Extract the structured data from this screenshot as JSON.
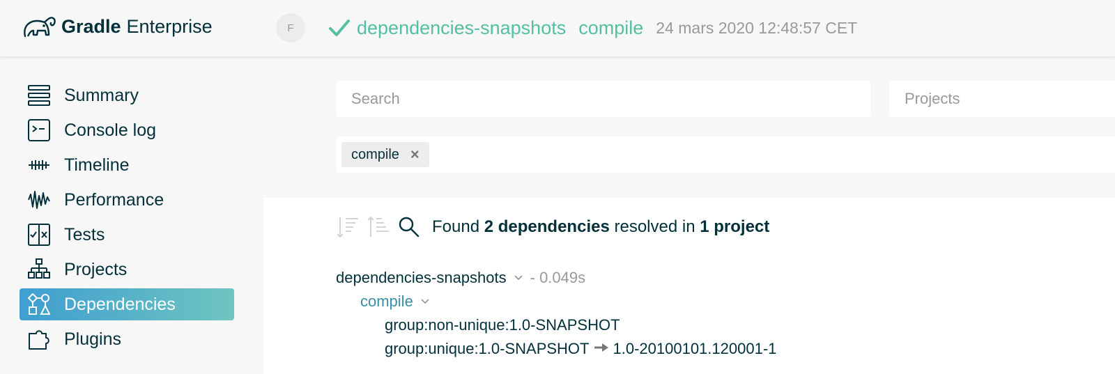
{
  "header": {
    "brand": "Gradle",
    "product": "Enterprise",
    "avatar_initial": "F",
    "build_project": "dependencies-snapshots",
    "build_task": "compile",
    "build_time": "24 mars 2020 12:48:57 CET"
  },
  "sidebar": {
    "items": [
      {
        "label": "Summary",
        "icon": "list-icon"
      },
      {
        "label": "Console log",
        "icon": "terminal-icon"
      },
      {
        "label": "Timeline",
        "icon": "timeline-icon"
      },
      {
        "label": "Performance",
        "icon": "waveform-icon"
      },
      {
        "label": "Tests",
        "icon": "tests-icon"
      },
      {
        "label": "Projects",
        "icon": "hierarchy-icon"
      },
      {
        "label": "Dependencies",
        "icon": "dependencies-icon"
      },
      {
        "label": "Plugins",
        "icon": "puzzle-icon"
      }
    ],
    "active": "Dependencies"
  },
  "filters": {
    "search_placeholder": "Search",
    "projects_placeholder": "Projects",
    "tag_label": "compile",
    "tag_close": "×"
  },
  "results": {
    "found_prefix": "Found",
    "dep_count": "2 dependencies",
    "resolved_in": "resolved in",
    "project_count": "1 project"
  },
  "tree": {
    "project": "dependencies-snapshots",
    "duration": "- 0.049s",
    "configuration": "compile",
    "dependencies": [
      {
        "name": "group:non-unique:1.0-SNAPSHOT",
        "resolved": ""
      },
      {
        "name": "group:unique:1.0-SNAPSHOT",
        "resolved": "1.0-20100101.120001-1"
      }
    ]
  },
  "colors": {
    "success": "#54bfa1",
    "active_start": "#3e9ed0",
    "active_end": "#6fc5c0",
    "text": "#02303a"
  }
}
